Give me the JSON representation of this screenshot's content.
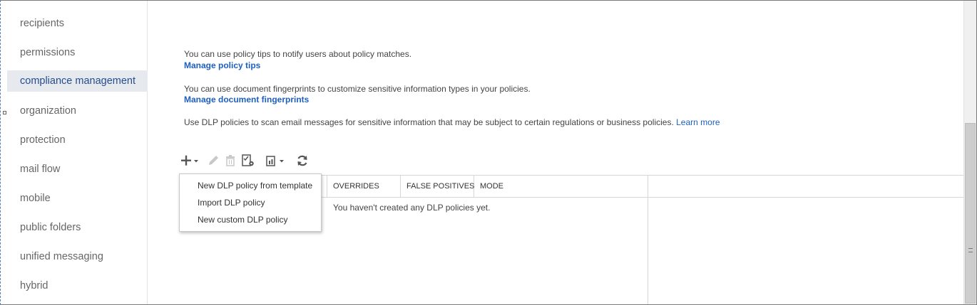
{
  "sidebar": {
    "items": [
      {
        "label": "recipients"
      },
      {
        "label": "permissions"
      },
      {
        "label": "compliance management"
      },
      {
        "label": "organization"
      },
      {
        "label": "protection"
      },
      {
        "label": "mail flow"
      },
      {
        "label": "mobile"
      },
      {
        "label": "public folders"
      },
      {
        "label": "unified messaging"
      },
      {
        "label": "hybrid"
      }
    ],
    "active": "compliance management"
  },
  "main": {
    "policy_tips_text": "You can use policy tips to notify users about policy matches.",
    "policy_tips_link": "Manage policy tips",
    "fingerprints_text": "You can use document fingerprints to customize sensitive information types in your policies.",
    "fingerprints_link": "Manage document fingerprints",
    "dlp_text": "Use DLP policies to scan email messages for sensitive information that may be subject to certain regulations or business policies.",
    "learn_more": "Learn more"
  },
  "toolbar": {
    "icons": [
      "plus-icon",
      "pencil-icon",
      "trash-icon",
      "checklist-gear-icon",
      "report-icon",
      "refresh-icon"
    ],
    "disabled_color": "#c8c8c8",
    "enabled_color": "#444444"
  },
  "grid": {
    "columns": [
      "OVERRIDES",
      "FALSE POSITIVES",
      "MODE"
    ],
    "empty_message": "You haven't created any DLP policies yet."
  },
  "dropdown": {
    "items": [
      {
        "label": "New DLP policy from template"
      },
      {
        "label": "Import DLP policy"
      },
      {
        "label": "New custom DLP policy"
      }
    ]
  },
  "colors": {
    "link": "#1f5fbf",
    "active_nav_bg": "#e6e9ee",
    "active_nav_text": "#264d8c"
  }
}
